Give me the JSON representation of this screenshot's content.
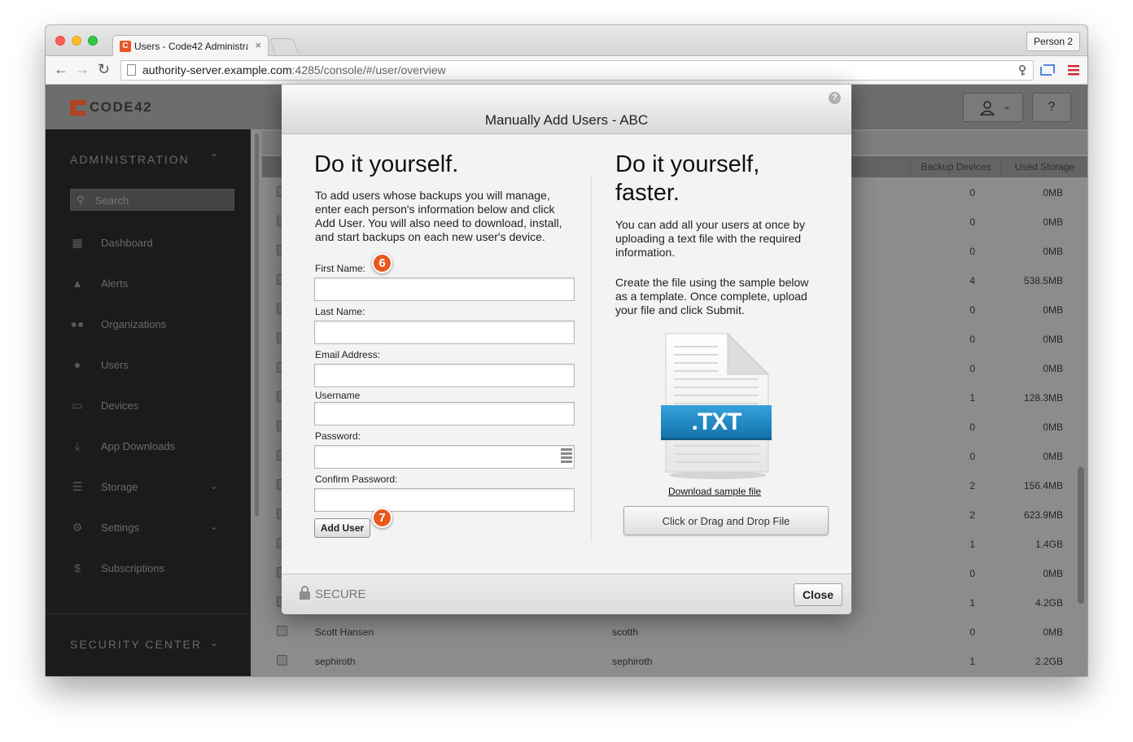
{
  "browser": {
    "tab_title": "Users - Code42 Administra",
    "tab_close": "×",
    "profile_button": "Person 2",
    "url_host": "authority-server.example.com",
    "url_rest": ":4285/console/#/user/overview",
    "traffic_lights": [
      "#fc5f57",
      "#fdbc2e",
      "#33c748"
    ],
    "icons": [
      "back-icon",
      "forward-icon",
      "reload-icon",
      "page-icon",
      "key-icon",
      "cast-icon",
      "menu-icon"
    ]
  },
  "app": {
    "logo_text": "CODE42",
    "help_label": "?",
    "brand_color": "#e8562a"
  },
  "sidebar": {
    "section_title": "ADMINISTRATION",
    "search_placeholder": "Search",
    "items": [
      {
        "label": "Dashboard",
        "icon": "dashboard-icon"
      },
      {
        "label": "Alerts",
        "icon": "alert-icon"
      },
      {
        "label": "Organizations",
        "icon": "organizations-icon"
      },
      {
        "label": "Users",
        "icon": "user-icon"
      },
      {
        "label": "Devices",
        "icon": "monitor-icon"
      },
      {
        "label": "App Downloads",
        "icon": "download-icon"
      },
      {
        "label": "Storage",
        "icon": "storage-icon"
      },
      {
        "label": "Settings",
        "icon": "gear-icon"
      },
      {
        "label": "Subscriptions",
        "icon": "dollar-icon"
      }
    ],
    "footer_section": "SECURITY CENTER"
  },
  "table": {
    "columns": [
      "Backup Devices",
      "Used Storage"
    ],
    "rows": [
      {
        "name": "",
        "username": "",
        "devices": "0",
        "storage": "0MB"
      },
      {
        "name": "",
        "username": "",
        "devices": "0",
        "storage": "0MB"
      },
      {
        "name": "",
        "username": "",
        "devices": "0",
        "storage": "0MB"
      },
      {
        "name": "",
        "username": "",
        "devices": "4",
        "storage": "538.5MB"
      },
      {
        "name": "",
        "username": "",
        "devices": "0",
        "storage": "0MB"
      },
      {
        "name": "",
        "username": "",
        "devices": "0",
        "storage": "0MB"
      },
      {
        "name": "",
        "username": "",
        "devices": "0",
        "storage": "0MB"
      },
      {
        "name": "",
        "username": "",
        "devices": "1",
        "storage": "128.3MB"
      },
      {
        "name": "",
        "username": "",
        "devices": "0",
        "storage": "0MB"
      },
      {
        "name": "",
        "username": "",
        "devices": "0",
        "storage": "0MB"
      },
      {
        "name": "",
        "username": "",
        "devices": "2",
        "storage": "156.4MB"
      },
      {
        "name": "",
        "username": "",
        "devices": "2",
        "storage": "623.9MB"
      },
      {
        "name": "",
        "username": "",
        "devices": "1",
        "storage": "1.4GB"
      },
      {
        "name": "",
        "username": "",
        "devices": "0",
        "storage": "0MB"
      },
      {
        "name": "",
        "username": "",
        "devices": "1",
        "storage": "4.2GB"
      },
      {
        "name": "Scott Hansen",
        "username": "scotth",
        "devices": "0",
        "storage": "0MB"
      },
      {
        "name": "sephiroth",
        "username": "sephiroth",
        "devices": "1",
        "storage": "2.2GB"
      }
    ]
  },
  "modal": {
    "title": "Manually Add Users - ABC",
    "help_label": "?",
    "left_heading": "Do it yourself.",
    "left_text": "To add users whose backups you will manage, enter each person's information below and click Add User. You will also need to download, install, and start backups on each new user's device.",
    "fields": {
      "first_name": "First Name:",
      "last_name": "Last Name:",
      "email": "Email Address:",
      "username": "Username",
      "password": "Password:",
      "confirm_password": "Confirm Password:"
    },
    "add_user_button": "Add User",
    "callouts": [
      "6",
      "7"
    ],
    "right_heading_1": "Do it yourself,",
    "right_heading_2": "faster.",
    "right_text_1": "You can add all your users at once by uploading a text file with the required information.",
    "right_text_2": "Create the file using the sample below as a template. Once complete, upload your file and click Submit.",
    "file_label": ".TXT",
    "download_link": "Download sample file",
    "drop_button": "Click or Drag and Drop File",
    "secure_label": "SECURE",
    "close_button": "Close"
  }
}
